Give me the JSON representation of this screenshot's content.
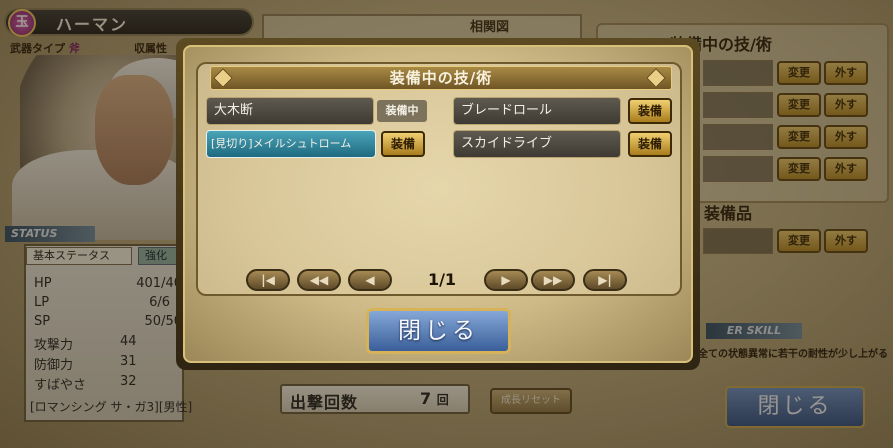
{
  "character": {
    "gem": "玉",
    "name": "ハーマン",
    "weapon_type_label": "武器タイプ",
    "weapon_type_value": "斧",
    "affiliation_label": "収属性"
  },
  "status": {
    "band_label": "STATUS",
    "tabs": [
      "基本ステータス",
      "強化"
    ],
    "stats": [
      {
        "label": "HP",
        "value": "401/40"
      },
      {
        "label": "LP",
        "value": "6/6"
      },
      {
        "label": "SP",
        "value": "50/50"
      },
      {
        "label": "攻撃力",
        "value": "44"
      },
      {
        "label": "防御力",
        "value": "31"
      },
      {
        "label": "すばやさ",
        "value": "32"
      }
    ],
    "title_tag": "[ロマンシング サ・ガ3]",
    "gender_tag": "[男性]"
  },
  "background": {
    "top_label": "相関図",
    "right_heading": "装備中の技/術",
    "change_label": "変更",
    "remove_label": "外す",
    "equipment_heading": "装備品",
    "skill_band": "ER SKILL",
    "skill_text": "全ての状態異常に若干の耐性が少し上がる",
    "sorties_label": "出撃回数",
    "sorties_value": "7",
    "sorties_unit": "回",
    "grow_reset_label": "成長リセット",
    "close_label": "閉じる"
  },
  "modal": {
    "title": "装備中の技/術",
    "skills": [
      {
        "label": "大木断",
        "status": "装備中"
      },
      {
        "label": "ブレードロール",
        "status": "装備"
      },
      {
        "label": "[見切り]メイルシュトローム",
        "status": "装備"
      },
      {
        "label": "スカイドライブ",
        "status": "装備"
      }
    ],
    "pager": {
      "first": "|◀",
      "prev_fast": "◀◀",
      "prev": "◀",
      "page": "1/1",
      "next": "▶",
      "next_fast": "▶▶",
      "last": "▶|"
    },
    "close_label": "閉じる"
  },
  "colors": {
    "gold": "#e8c86c",
    "panel_dark": "#3e3a33",
    "selected_teal": "#1f6a80",
    "close_blue": "#3a5e99"
  }
}
